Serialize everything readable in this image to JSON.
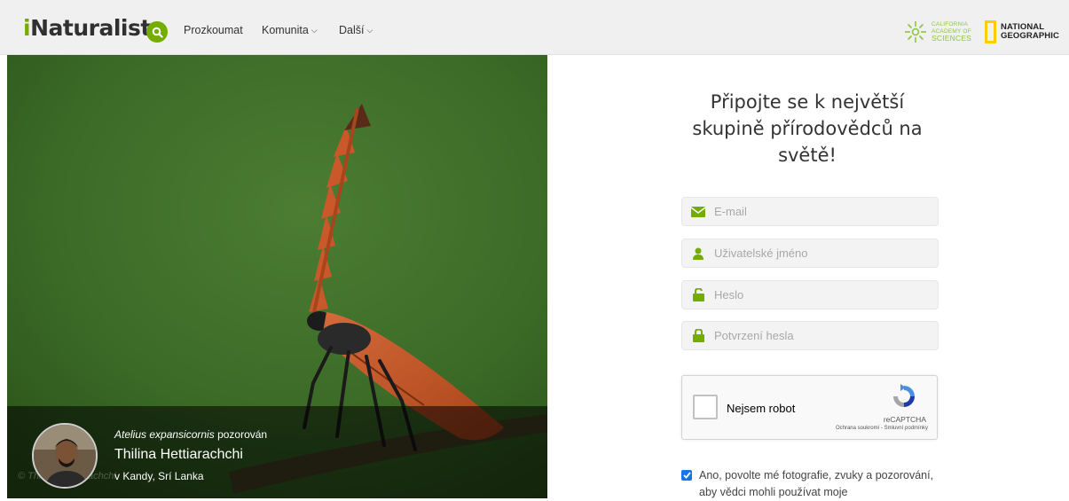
{
  "header": {
    "logo_prefix": "i",
    "logo_rest": "Naturalist",
    "nav": [
      {
        "label": "Prozkoumat",
        "dropdown": false
      },
      {
        "label": "Komunita",
        "dropdown": true
      },
      {
        "label": "Další",
        "dropdown": true
      }
    ],
    "partner_cas": [
      "CALIFORNIA",
      "ACADEMY OF",
      "SCIENCES"
    ],
    "partner_natgeo": [
      "NATIONAL",
      "GEOGRAPHIC"
    ]
  },
  "photo": {
    "taxon": "Atelius expansicornis",
    "verb": " pozorován",
    "observer": "Thilina Hettiarachchi",
    "place": "v Kandy, Srí Lanka",
    "copyright": "© Thilina Hettiarachchi"
  },
  "form": {
    "title": "Připojte se k největší skupině přírodovědců na světě!",
    "fields": [
      {
        "placeholder": "E-mail",
        "icon": "envelope-icon"
      },
      {
        "placeholder": "Uživatelské jméno",
        "icon": "user-icon"
      },
      {
        "placeholder": "Heslo",
        "icon": "unlocked-icon"
      },
      {
        "placeholder": "Potvrzení hesla",
        "icon": "lock-icon"
      }
    ],
    "captcha": {
      "label": "Nejsem robot",
      "brand": "reCAPTCHA",
      "links": "Ochrana soukromí - Smluvní podmínky"
    },
    "consent": "Ano, povolte mé fotografie, zvuky a pozorování, aby vědci mohli používat moje"
  },
  "colors": {
    "brand_green": "#74ac00",
    "header_bg": "#f0f0f0",
    "natgeo_yellow": "#ffce00",
    "checkbox_blue": "#1a73e8"
  }
}
